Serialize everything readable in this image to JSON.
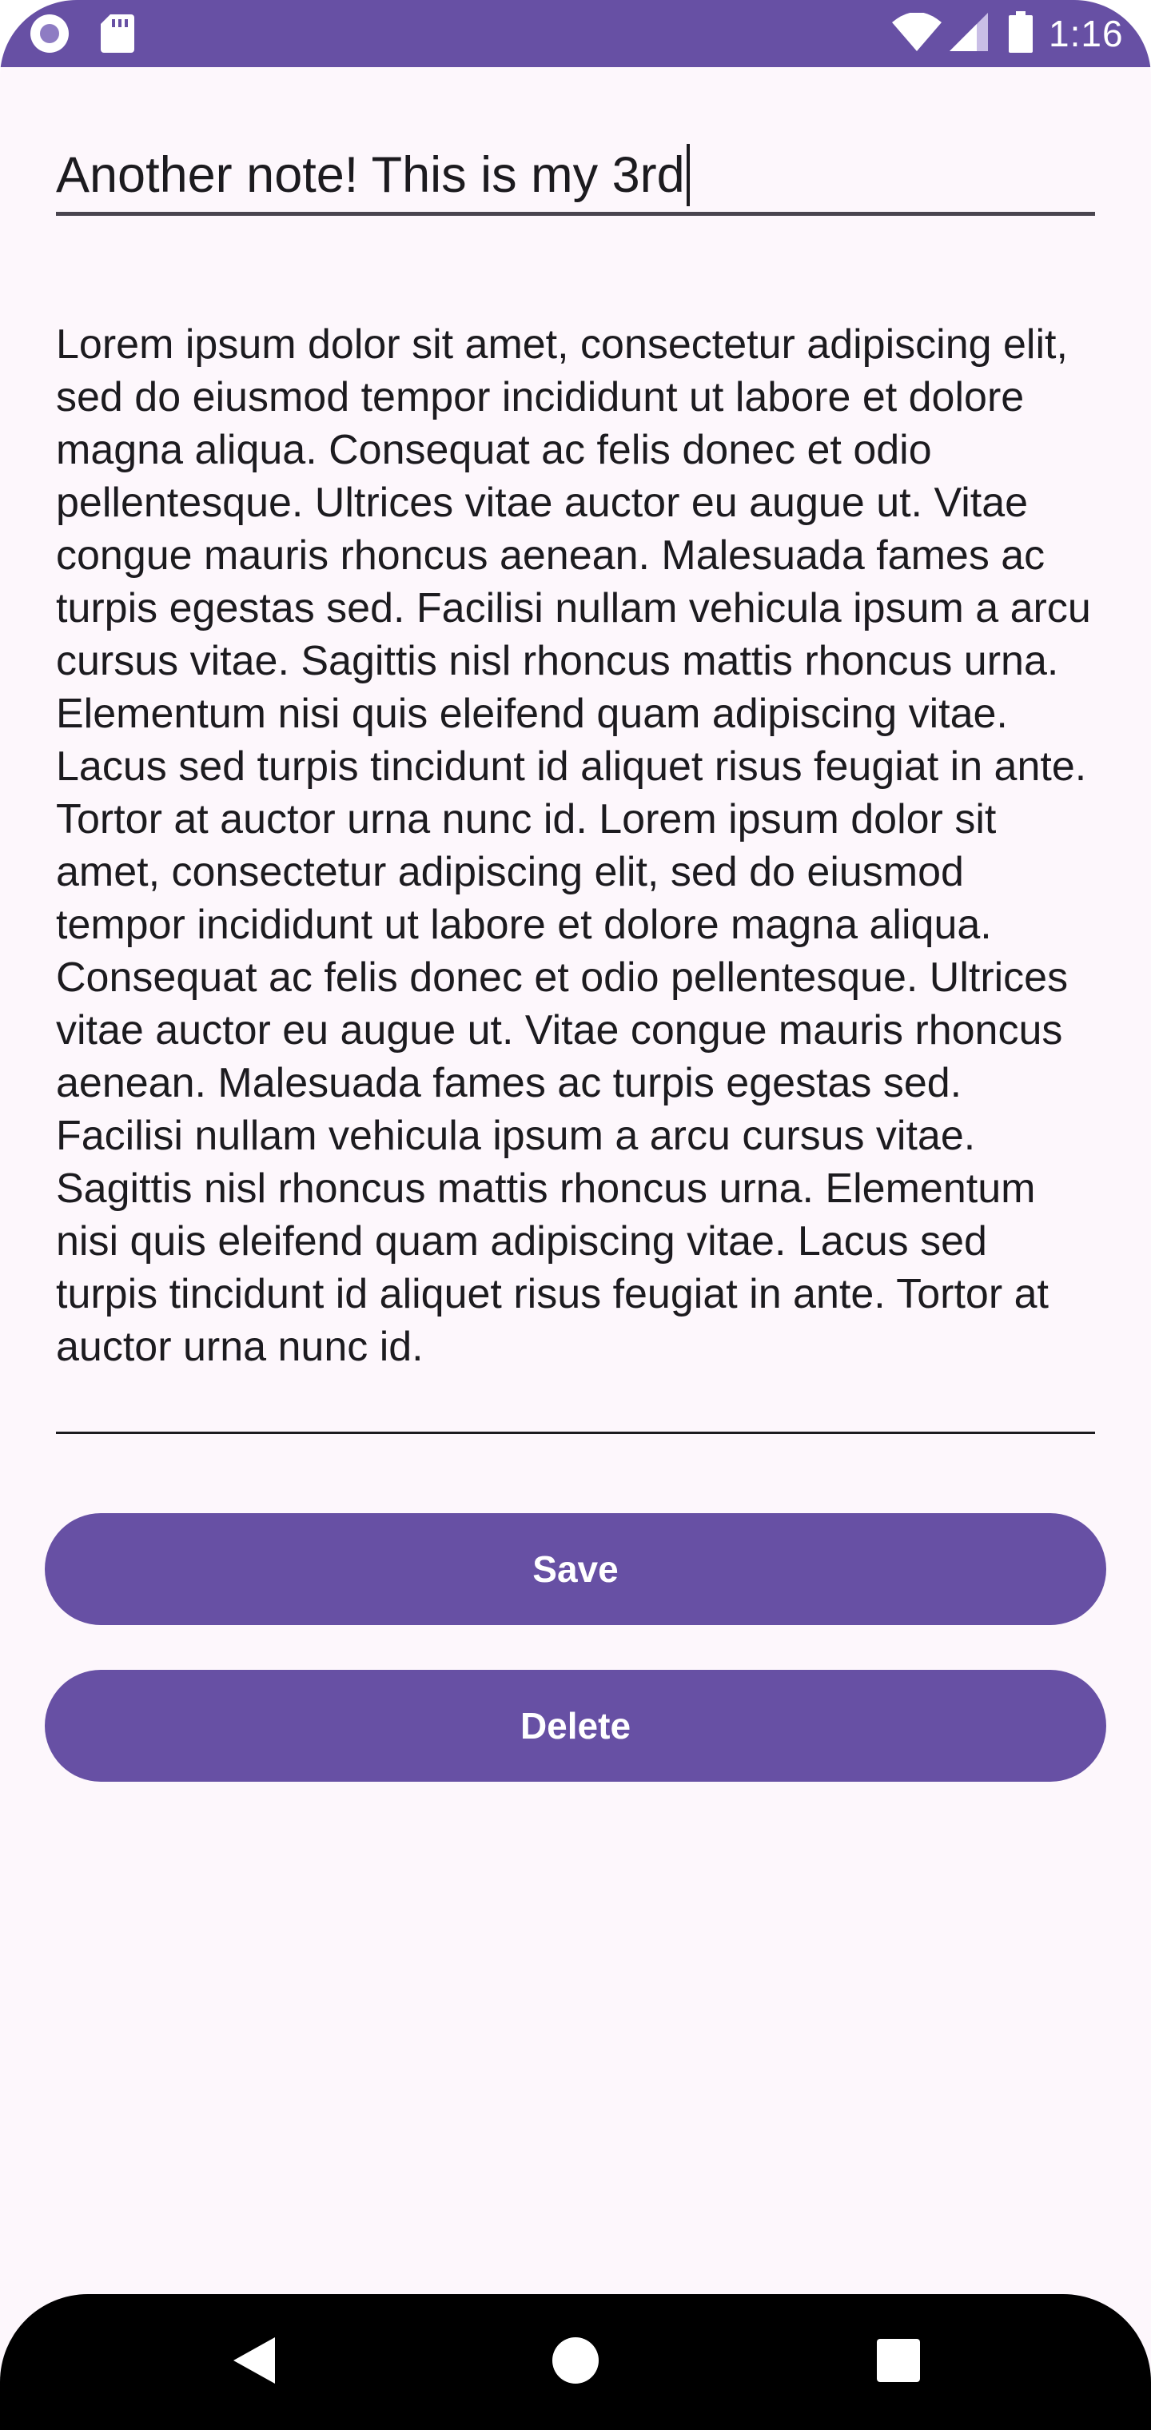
{
  "status_bar": {
    "time": "1:16",
    "icons": [
      "record-indicator-icon",
      "sd-card-icon",
      "wifi-icon",
      "signal-icon",
      "battery-icon"
    ]
  },
  "note": {
    "title_value": "Another note! This is my 3rd",
    "body_value": "Lorem ipsum dolor sit amet, consectetur adipiscing elit, sed do eiusmod tempor incididunt ut labore et dolore magna aliqua. Consequat ac felis donec et odio pellentesque. Ultrices vitae auctor eu augue ut. Vitae congue mauris rhoncus aenean. Malesuada fames ac turpis egestas sed. Facilisi nullam vehicula ipsum a arcu cursus vitae. Sagittis nisl rhoncus mattis rhoncus urna. Elementum nisi quis eleifend quam adipiscing vitae. Lacus sed turpis tincidunt id aliquet risus feugiat in ante. Tortor at auctor urna nunc id. Lorem ipsum dolor sit amet, consectetur adipiscing elit, sed do eiusmod tempor incididunt ut labore et dolore magna aliqua. Consequat ac felis donec et odio pellentesque. Ultrices vitae auctor eu augue ut. Vitae congue mauris rhoncus aenean. Malesuada fames ac turpis egestas sed. Facilisi nullam vehicula ipsum a arcu cursus vitae. Sagittis nisl rhoncus mattis rhoncus urna. Elementum nisi quis eleifend quam adipiscing vitae. Lacus sed turpis tincidunt id aliquet risus feugiat in ante. Tortor at auctor urna nunc id."
  },
  "actions": {
    "save_label": "Save",
    "delete_label": "Delete"
  },
  "navigation": {
    "icons": [
      "back-icon",
      "home-icon",
      "recents-icon"
    ]
  },
  "colors": {
    "primary": "#6750A4",
    "background": "#FDF7FC",
    "on_surface": "#1C1B1F",
    "on_primary": "#FFFFFF"
  }
}
